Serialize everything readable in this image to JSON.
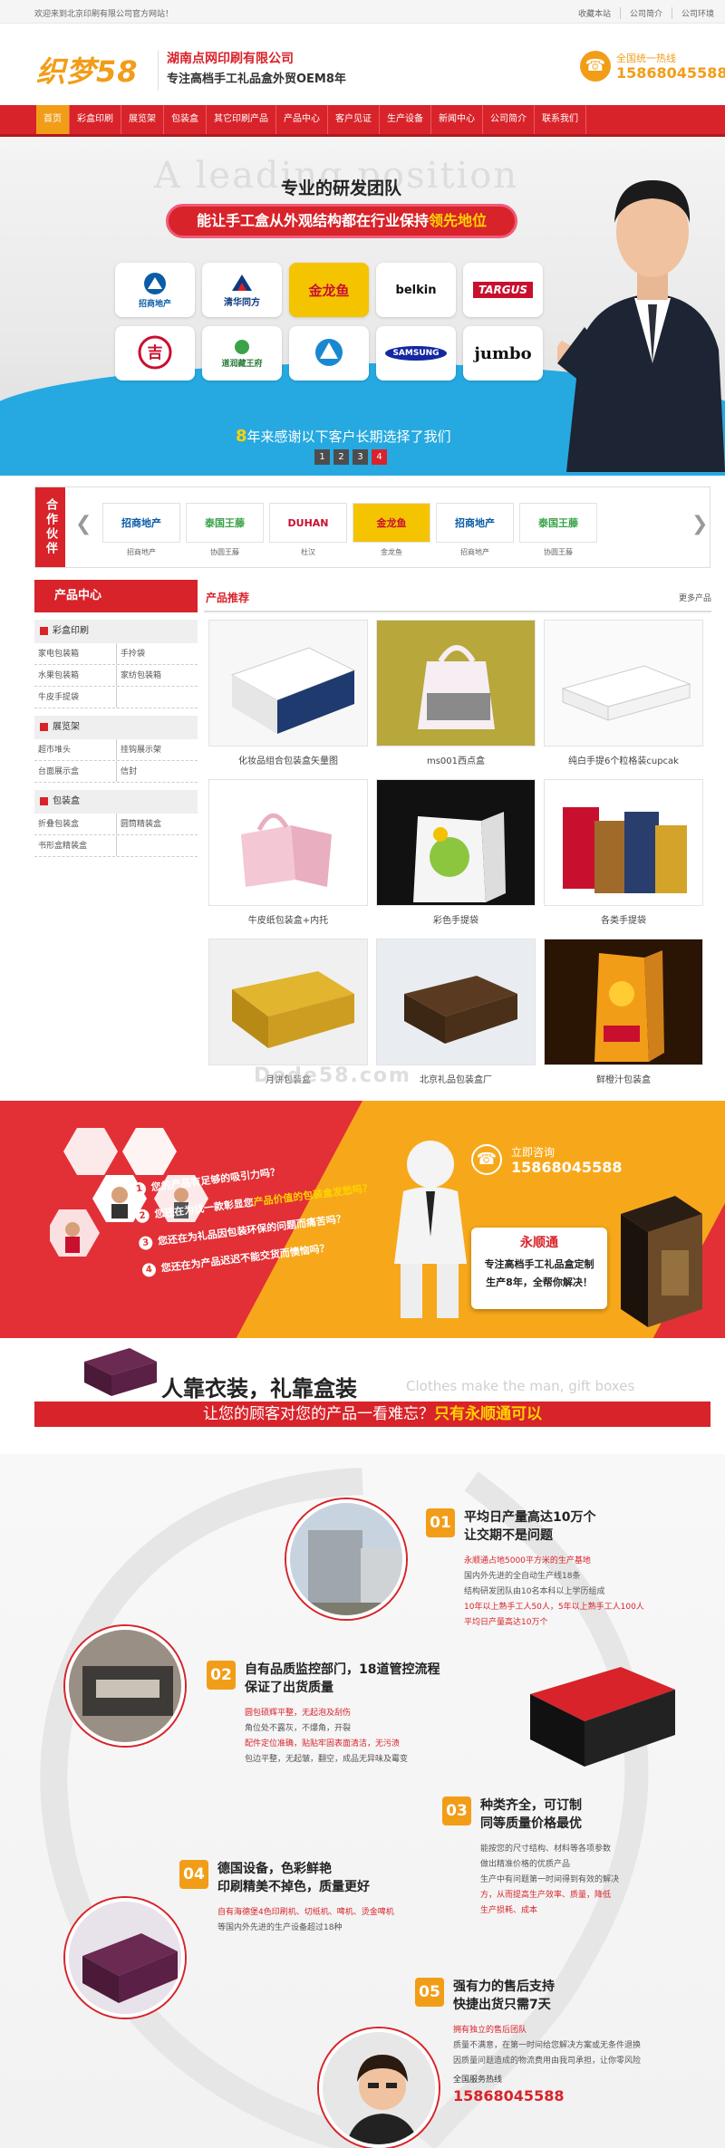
{
  "topbar": {
    "welcome": "欢迎来到北京印刷有限公司官方网站！",
    "links": [
      "收藏本站",
      "公司简介",
      "公司环境"
    ]
  },
  "header": {
    "logo": "织梦58",
    "company": "湖南点网印刷有限公司",
    "slogan": "专注高档手工礼品盒外贸OEM8年",
    "hotline_label": "全国统一热线",
    "hotline": "15868045588"
  },
  "nav": [
    "首页",
    "彩盒印刷",
    "展览架",
    "包装盒",
    "其它印刷产品",
    "产品中心",
    "客户见证",
    "生产设备",
    "新闻中心",
    "公司简介",
    "联系我们"
  ],
  "banner": {
    "ghost": "A leading position",
    "title": "专业的研发团队",
    "pill_text": "能让手工盒从外观结构都在行业保持",
    "pill_highlight": "领先地位",
    "brands": [
      "招商地产",
      "清华同方",
      "金龙鱼",
      "belkin",
      "TARGUS",
      "吉",
      "道润藏王府",
      "",
      "SAMSUNG",
      "jumbo"
    ],
    "slogan_num": "8",
    "slogan": "年来感谢以下客户长期选择了我们",
    "pages": [
      "1",
      "2",
      "3",
      "4"
    ],
    "active_page": "4"
  },
  "partners": {
    "title": "合作伙伴",
    "prev": "❮",
    "next": "❯",
    "items": [
      {
        "logo": "招商地产",
        "name": "招商地产"
      },
      {
        "logo": "泰国王藤",
        "name": "协圆王藤"
      },
      {
        "logo": "DUHAN",
        "name": "杜汉"
      },
      {
        "logo": "金龙鱼",
        "name": "金龙鱼"
      },
      {
        "logo": "招商地产",
        "name": "招商地产"
      },
      {
        "logo": "泰国王藤",
        "name": "协圆王藤"
      }
    ]
  },
  "sidebar": {
    "title": "产品中心",
    "cats": [
      {
        "name": "彩盒印刷",
        "rows": [
          [
            "家电包装箱",
            "手拎袋"
          ],
          [
            "水果包装箱",
            "家纺包装箱"
          ],
          [
            "牛皮手提袋",
            ""
          ]
        ]
      },
      {
        "name": "展览架",
        "rows": [
          [
            "超市堆头",
            "挂钩展示架"
          ],
          [
            "台面展示盒",
            "信封"
          ]
        ]
      },
      {
        "name": "包装盒",
        "rows": [
          [
            "折叠包装盒",
            "圆筒精装盒"
          ],
          [
            "书形盒精装盒",
            ""
          ]
        ]
      }
    ]
  },
  "products": {
    "title": "产品推荐",
    "more": "更多产品",
    "items": [
      "化妆品组合包装盒矢量图",
      "ms001西点盒",
      "纯白手提6个粒格装cupcak",
      "牛皮纸包装盒+内托",
      "彩色手提袋",
      "各类手提袋",
      "月饼包装盒",
      "北京礼品包装盒厂",
      "鲜橙汁包装盒"
    ]
  },
  "watermark": "Dede58.com",
  "promo": {
    "questions": [
      {
        "n": "1",
        "t": "您的产品有足够的吸引力吗？",
        "y": ""
      },
      {
        "n": "2",
        "t": "您还在为找一款彰显您",
        "y": "产品价值的包装盒发愁吗？"
      },
      {
        "n": "3",
        "t": "您还在为礼品因包装环保的问题而痛苦吗？",
        "y": ""
      },
      {
        "n": "4",
        "t": "您还在为产品迟迟不能交货而懊恼吗？",
        "y": ""
      }
    ],
    "call_label": "立即咨询",
    "call_number": "15868045588",
    "brand": "永顺通",
    "desc1": "专注高档手工礼品盒定制",
    "desc2": "生产8年，全帮你解决！"
  },
  "tagline": {
    "title": "人靠衣装，礼靠盒装",
    "english": "Clothes make the man, gift boxes",
    "bar": "让您的顾客对您的产品一看难忘？",
    "bar_highlight": "只有永顺通可以"
  },
  "features": [
    {
      "n": "01",
      "title": [
        "平均日产量高达10万个",
        "让交期不是问题"
      ],
      "lines": [
        {
          "t": "永顺通占地5000平方米的生产基地",
          "r": true
        },
        {
          "t": "国内外先进的全自动生产线18条",
          "r": false
        },
        {
          "t": "结构研发团队由10名本科以上学历组成",
          "r": false
        },
        {
          "t": "10年以上熟手工人50人，5年以上熟手工人100人",
          "r": true
        },
        {
          "t": "平均日产量高达10万个",
          "r": true
        }
      ]
    },
    {
      "n": "02",
      "title": [
        "自有品质监控部门，18道管控流程",
        "保证了出货质量"
      ],
      "lines": [
        {
          "t": "圆包硕辉平整，无起泡及刮伤",
          "r": true
        },
        {
          "t": "角位处不露灰，不爆角，开裂",
          "r": false
        },
        {
          "t": "配件定位准确，贴贴牢固表面清洁，无污渍",
          "r": true
        },
        {
          "t": "包边平整，无起皱，翻空，成品无异味及霉变",
          "r": false
        }
      ]
    },
    {
      "n": "03",
      "title": [
        "种类齐全，可订制",
        "同等质量价格最优"
      ],
      "lines": [
        {
          "t": "能按您的尺寸结构、材料等各项参数",
          "r": false
        },
        {
          "t": "做出精准价格的优质产品",
          "r": false
        },
        {
          "t": "生产中有问题第一时间得到有效的解决",
          "r": false
        },
        {
          "t": "方，从而提高生产效率、质量，降低",
          "r": true
        },
        {
          "t": "生产损耗、成本",
          "r": true
        }
      ]
    },
    {
      "n": "04",
      "title": [
        "德国设备，色彩鲜艳",
        "印刷精美不掉色，质量更好"
      ],
      "lines": [
        {
          "t": "自有海德堡4色印刷机、切纸机、啤机、烫金啤机",
          "r": true
        },
        {
          "t": "等国内外先进的生产设备超过18种",
          "r": false
        }
      ]
    },
    {
      "n": "05",
      "title": [
        "强有力的售后支持",
        "快捷出货只需7天"
      ],
      "lines": [
        {
          "t": "拥有独立的售后团队",
          "r": true
        },
        {
          "t": "质量不满意，在第一时间给您解决方案或无条件退换",
          "r": false
        },
        {
          "t": "因质量问题造成的物流费用由我司承担，让你零风险",
          "r": false
        }
      ],
      "hotline_label": "全国服务热线",
      "hotline": "15868045588"
    }
  ],
  "colors": {
    "red": "#d8232a",
    "orange": "#f29d18",
    "blue": "#26a9e0",
    "yellow": "#ffd200"
  }
}
